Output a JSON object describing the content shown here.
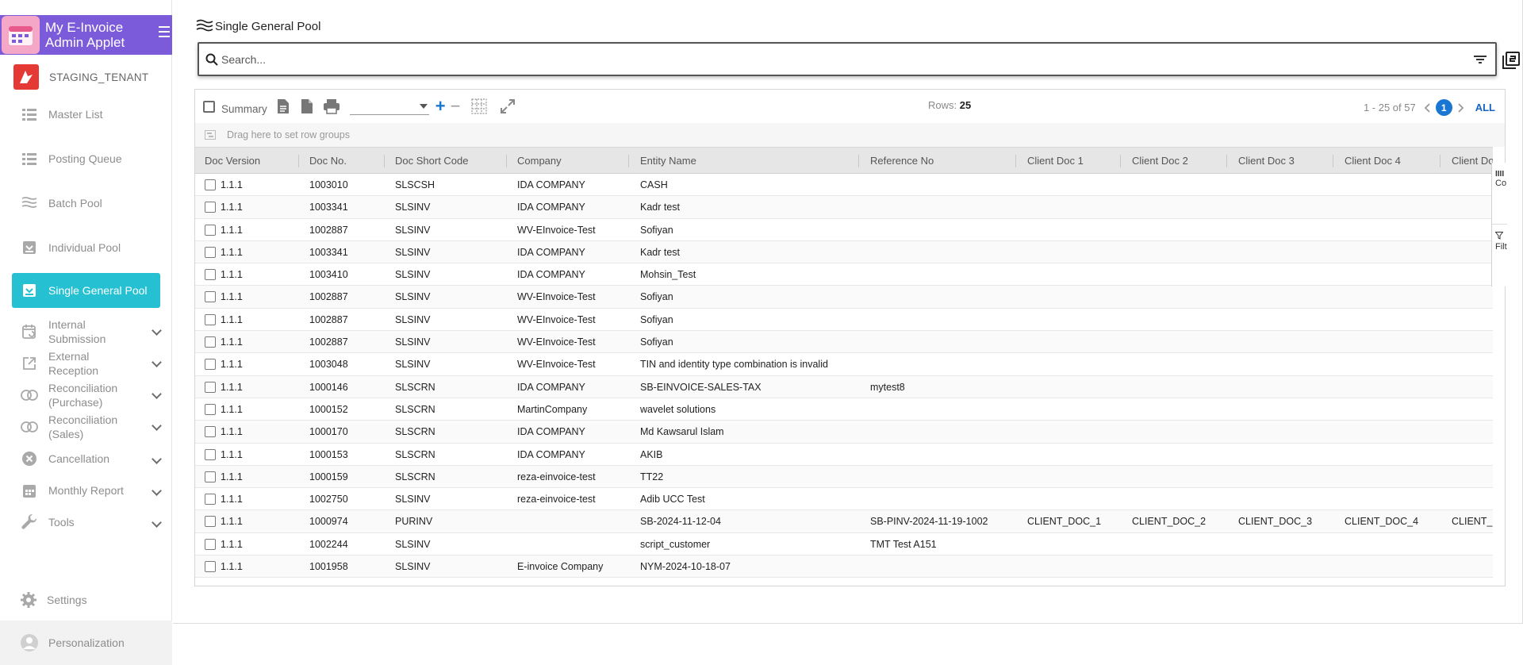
{
  "brand": {
    "title_line1": "My E-Invoice",
    "title_line2": "Admin Applet"
  },
  "tenant": {
    "name": "STAGING_TENANT"
  },
  "sidebar": {
    "items": [
      {
        "label": "Master List",
        "icon": "list-icon"
      },
      {
        "label": "Posting Queue",
        "icon": "list-icon"
      },
      {
        "label": "Batch Pool",
        "icon": "waves-icon"
      },
      {
        "label": "Individual Pool",
        "icon": "inbox-icon"
      },
      {
        "label": "Single General Pool",
        "icon": "inbox-icon"
      }
    ],
    "groups": [
      {
        "line1": "Internal",
        "line2": "Submission",
        "icon": "calendar-sync-icon"
      },
      {
        "line1": "External",
        "line2": "Reception",
        "icon": "external-link-icon"
      },
      {
        "line1": "Reconciliation",
        "line2": "(Purchase)",
        "icon": "circles-icon"
      },
      {
        "line1": "Reconciliation",
        "line2": "(Sales)",
        "icon": "circles-icon"
      },
      {
        "line1": "Cancellation",
        "line2": "",
        "icon": "cancel-icon"
      },
      {
        "line1": "Monthly Report",
        "line2": "",
        "icon": "calendar-icon"
      },
      {
        "line1": "Tools",
        "line2": "",
        "icon": "wrench-icon"
      }
    ],
    "settings_label": "Settings",
    "personalization_label": "Personalization"
  },
  "page": {
    "title": "Single General Pool"
  },
  "search": {
    "placeholder": "Search...",
    "value": ""
  },
  "toolbar": {
    "summary_label": "Summary",
    "rows_label": "Rows:",
    "rows_value": "25",
    "range": "1 - 25 of 57",
    "current_page": "1",
    "all_label": "ALL"
  },
  "group_hint": "Drag here to set row groups",
  "columns": [
    "Doc Version",
    "Doc No.",
    "Doc Short Code",
    "Company",
    "Entity Name",
    "Reference No",
    "Client Doc 1",
    "Client Doc 2",
    "Client Doc 3",
    "Client Doc 4",
    "Client Doc"
  ],
  "side_panel": {
    "columns_label": "Co",
    "filters_label": "Filt"
  },
  "rows": [
    [
      "1.1.1",
      "1003010",
      "SLSCSH",
      "IDA COMPANY",
      "CASH",
      "",
      "",
      "",
      "",
      "",
      ""
    ],
    [
      "1.1.1",
      "1003341",
      "SLSINV",
      "IDA COMPANY",
      "Kadr test",
      "",
      "",
      "",
      "",
      "",
      ""
    ],
    [
      "1.1.1",
      "1002887",
      "SLSINV",
      "WV-EInvoice-Test",
      "Sofiyan",
      "",
      "",
      "",
      "",
      "",
      ""
    ],
    [
      "1.1.1",
      "1003341",
      "SLSINV",
      "IDA COMPANY",
      "Kadr test",
      "",
      "",
      "",
      "",
      "",
      ""
    ],
    [
      "1.1.1",
      "1003410",
      "SLSINV",
      "IDA COMPANY",
      "Mohsin_Test",
      "",
      "",
      "",
      "",
      "",
      ""
    ],
    [
      "1.1.1",
      "1002887",
      "SLSINV",
      "WV-EInvoice-Test",
      "Sofiyan",
      "",
      "",
      "",
      "",
      "",
      ""
    ],
    [
      "1.1.1",
      "1002887",
      "SLSINV",
      "WV-EInvoice-Test",
      "Sofiyan",
      "",
      "",
      "",
      "",
      "",
      ""
    ],
    [
      "1.1.1",
      "1002887",
      "SLSINV",
      "WV-EInvoice-Test",
      "Sofiyan",
      "",
      "",
      "",
      "",
      "",
      ""
    ],
    [
      "1.1.1",
      "1003048",
      "SLSINV",
      "WV-EInvoice-Test",
      "TIN and identity type combination is invalid",
      "",
      "",
      "",
      "",
      "",
      ""
    ],
    [
      "1.1.1",
      "1000146",
      "SLSCRN",
      "IDA COMPANY",
      "SB-EINVOICE-SALES-TAX",
      "mytest8",
      "",
      "",
      "",
      "",
      ""
    ],
    [
      "1.1.1",
      "1000152",
      "SLSCRN",
      "MartinCompany",
      "wavelet solutions",
      "",
      "",
      "",
      "",
      "",
      ""
    ],
    [
      "1.1.1",
      "1000170",
      "SLSCRN",
      "IDA COMPANY",
      "Md Kawsarul Islam",
      "",
      "",
      "",
      "",
      "",
      ""
    ],
    [
      "1.1.1",
      "1000153",
      "SLSCRN",
      "IDA COMPANY",
      "AKIB",
      "",
      "",
      "",
      "",
      "",
      ""
    ],
    [
      "1.1.1",
      "1000159",
      "SLSCRN",
      "reza-einvoice-test",
      "TT22",
      "",
      "",
      "",
      "",
      "",
      ""
    ],
    [
      "1.1.1",
      "1002750",
      "SLSINV",
      "reza-einvoice-test",
      "Adib UCC Test",
      "",
      "",
      "",
      "",
      "",
      ""
    ],
    [
      "1.1.1",
      "1000974",
      "PURINV",
      "",
      "SB-2024-11-12-04",
      "SB-PINV-2024-11-19-1002",
      "CLIENT_DOC_1",
      "CLIENT_DOC_2",
      "CLIENT_DOC_3",
      "CLIENT_DOC_4",
      "CLIENT_"
    ],
    [
      "1.1.1",
      "1002244",
      "SLSINV",
      "",
      "script_customer",
      "TMT Test A151",
      "",
      "",
      "",
      "",
      ""
    ],
    [
      "1.1.1",
      "1001958",
      "SLSINV",
      "E-invoice Company",
      "NYM-2024-10-18-07",
      "",
      "",
      "",
      "",
      "",
      ""
    ]
  ],
  "colors": {
    "brand": "#7b5bd9",
    "active_nav": "#26c0d3",
    "tenant_logo": "#e53935",
    "page_badge": "#1976d2"
  }
}
